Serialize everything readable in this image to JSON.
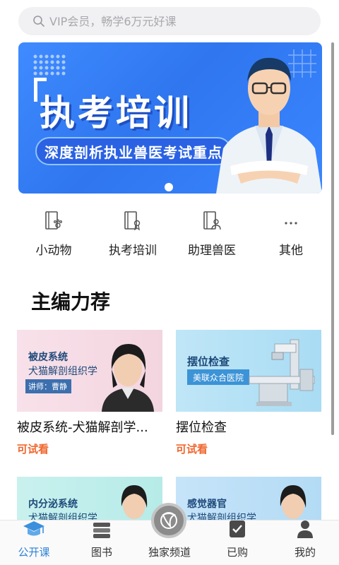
{
  "search": {
    "placeholder": "VIP会员，畅学6万元好课"
  },
  "banner": {
    "title": "执考培训",
    "subtitle": "深度剖析执业兽医考试重点"
  },
  "categories": [
    {
      "label": "小动物",
      "icon": "paw-book-icon"
    },
    {
      "label": "执考培训",
      "icon": "certificate-book-icon"
    },
    {
      "label": "助理兽医",
      "icon": "person-book-icon"
    },
    {
      "label": "其他",
      "icon": "more-dots-icon"
    }
  ],
  "section": {
    "title": "主编力荐"
  },
  "courses": [
    {
      "thumb_title": "被皮系统",
      "thumb_sub": "犬猫解剖组织学",
      "thumb_lecturer": "讲师：曹静",
      "name": "被皮系统-犬猫解剖学...",
      "trial": "可试看"
    },
    {
      "thumb_title": "摆位检查",
      "thumb_tag": "美联众合医院",
      "name": "摆位检查",
      "trial": "可试看"
    },
    {
      "thumb_title": "内分泌系统",
      "thumb_sub": "犬猫解剖组织学"
    },
    {
      "thumb_title": "感觉器官",
      "thumb_sub": "犬猫解剖组织学"
    }
  ],
  "nav": [
    {
      "label": "公开课",
      "icon": "graduation-cap-icon",
      "active": true
    },
    {
      "label": "图书",
      "icon": "books-icon"
    },
    {
      "label": "独家频道",
      "icon": "channel-icon"
    },
    {
      "label": "已购",
      "icon": "purchased-check-icon"
    },
    {
      "label": "我的",
      "icon": "profile-icon"
    }
  ],
  "colors": {
    "accent": "#2f83d6",
    "trial": "#f0672e",
    "banner": "#3f8bff"
  }
}
